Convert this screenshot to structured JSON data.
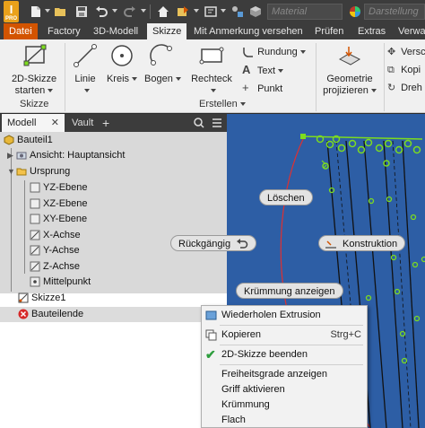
{
  "app": {
    "logo_text": "I",
    "logo_sub": "PRO"
  },
  "quick_access": {
    "material_placeholder": "Material",
    "appearance_placeholder": "Darstellung"
  },
  "tabs": [
    {
      "label": "Datei"
    },
    {
      "label": "Factory"
    },
    {
      "label": "3D-Modell"
    },
    {
      "label": "Skizze"
    },
    {
      "label": "Mit Anmerkung versehen"
    },
    {
      "label": "Prüfen"
    },
    {
      "label": "Extras"
    },
    {
      "label": "Verwal"
    }
  ],
  "ribbon": {
    "skizze_panel": {
      "button_line1": "2D-Skizze",
      "button_line2": "starten",
      "panel_label": "Skizze"
    },
    "erstellen_panel": {
      "linie": "Linie",
      "kreis": "Kreis",
      "bogen": "Bogen",
      "rechteck": "Rechteck",
      "rundung": "Rundung",
      "text": "Text",
      "punkt": "Punkt",
      "panel_label": "Erstellen"
    },
    "geometrie": {
      "line1": "Geometrie",
      "line2": "projizieren"
    },
    "modify": {
      "verschieben": "Versch",
      "kopieren": "Kopi",
      "drehen": "Dreh"
    }
  },
  "browser": {
    "tabs": [
      {
        "label": "Modell"
      },
      {
        "label": "Vault"
      }
    ],
    "close_glyph": "✕",
    "add_glyph": "+",
    "nodes": [
      {
        "label": "Bauteil1"
      },
      {
        "label": "Ansicht: Hauptansicht"
      },
      {
        "label": "Ursprung"
      },
      {
        "label": "YZ-Ebene"
      },
      {
        "label": "XZ-Ebene"
      },
      {
        "label": "XY-Ebene"
      },
      {
        "label": "X-Achse"
      },
      {
        "label": "Y-Achse"
      },
      {
        "label": "Z-Achse"
      },
      {
        "label": "Mittelpunkt"
      },
      {
        "label": "Skizze1"
      },
      {
        "label": "Bauteilende"
      }
    ]
  },
  "marking_menu": {
    "loeschen": "Löschen",
    "rueckgaengig": "Rückgängig",
    "konstruktion": "Konstruktion",
    "kruemmung": "Krümmung anzeigen"
  },
  "context_menu": {
    "items": [
      {
        "label": "Wiederholen Extrusion",
        "shortcut": ""
      },
      {
        "label": "Kopieren",
        "shortcut": "Strg+C"
      },
      {
        "label": "2D-Skizze beenden",
        "shortcut": ""
      },
      {
        "label": "Freiheitsgrade anzeigen",
        "shortcut": ""
      },
      {
        "label": "Griff aktivieren",
        "shortcut": ""
      },
      {
        "label": "Krümmung",
        "shortcut": ""
      },
      {
        "label": "Flach",
        "shortcut": ""
      }
    ]
  },
  "colors": {
    "file_tab": "#d35400",
    "canvas_bg": "#2d5ea5",
    "sketch_green": "#7ddc1f",
    "curve_red": "#e03030"
  }
}
